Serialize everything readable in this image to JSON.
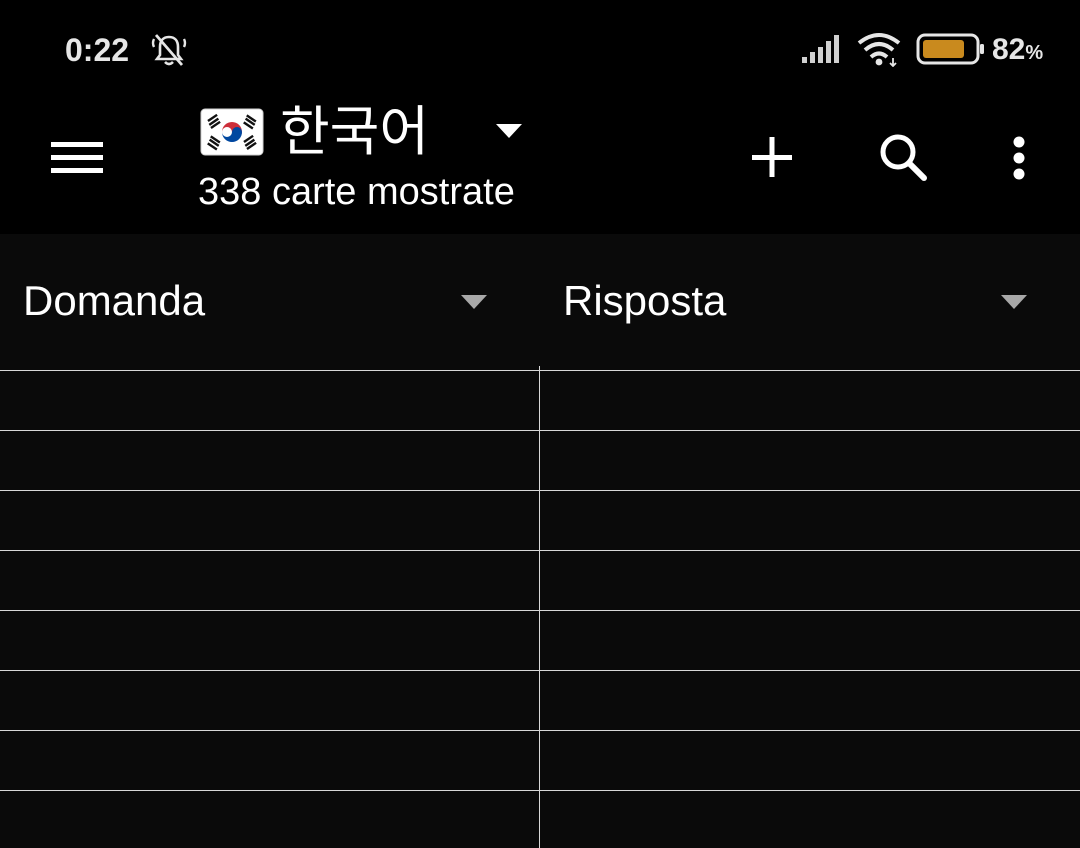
{
  "status_bar": {
    "time": "0:22",
    "battery_percent": "82",
    "battery_percent_sign": "%",
    "battery_level": 0.82,
    "battery_color": "#c98a1e",
    "icons": [
      "mute-notifications-icon",
      "signal-icon",
      "wifi-icon",
      "battery-icon"
    ]
  },
  "app_bar": {
    "menu_icon": "hamburger-menu-icon",
    "flag_icon": "south-korea-flag-icon",
    "deck_name": "한국어",
    "subtitle": "338 carte mostrate",
    "actions": [
      "add-icon",
      "search-icon",
      "more-vert-icon"
    ]
  },
  "table": {
    "columns": [
      {
        "label": "Domanda"
      },
      {
        "label": "Risposta"
      }
    ],
    "rows": [
      [
        "",
        ""
      ],
      [
        "",
        ""
      ],
      [
        "",
        ""
      ],
      [
        "",
        ""
      ],
      [
        "",
        ""
      ],
      [
        "",
        ""
      ],
      [
        "",
        ""
      ],
      [
        "",
        ""
      ]
    ]
  }
}
